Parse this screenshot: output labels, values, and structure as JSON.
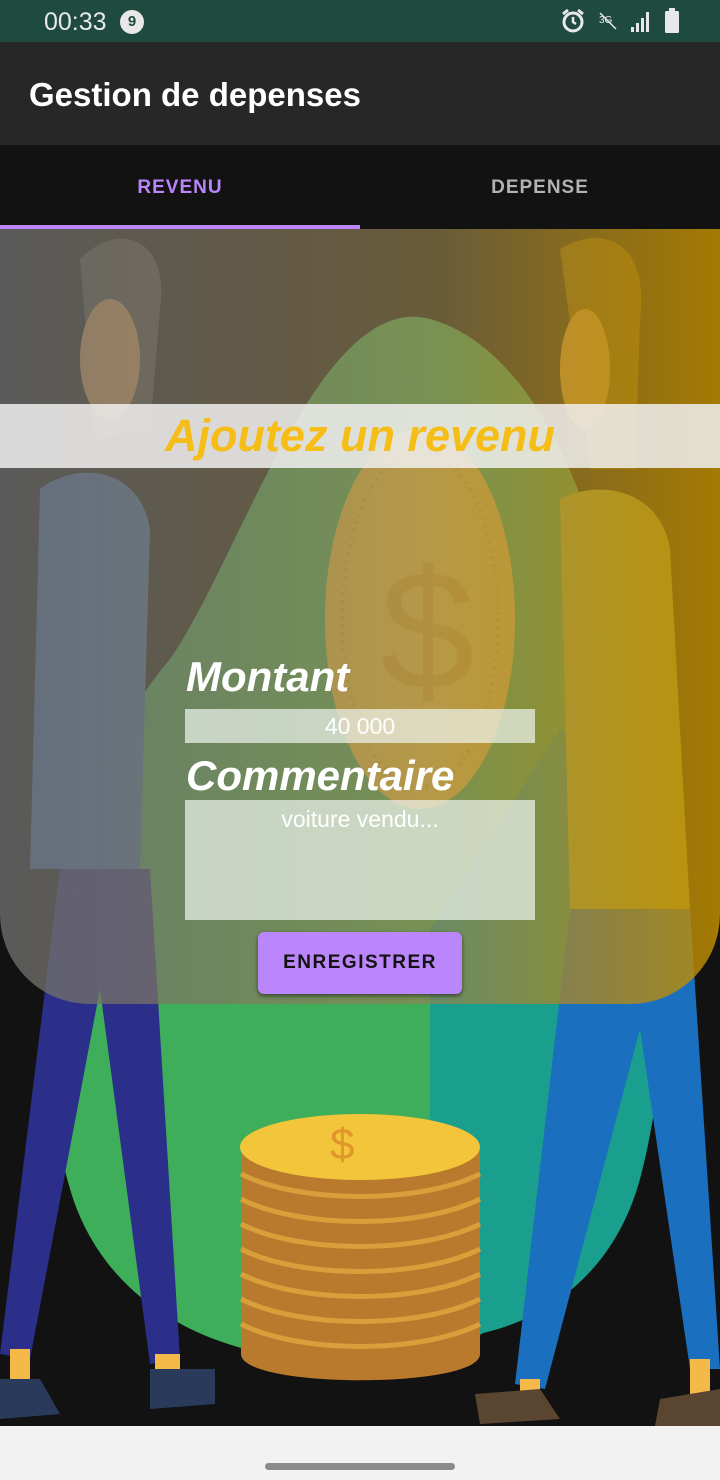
{
  "status_bar": {
    "time": "00:33",
    "notification_count": "9"
  },
  "app_bar": {
    "title": "Gestion de depenses"
  },
  "tabs": [
    {
      "label": "REVENU"
    },
    {
      "label": "DEPENSE"
    }
  ],
  "form": {
    "heading": "Ajoutez un revenu",
    "montant_label": "Montant",
    "montant_placeholder": "40 000",
    "commentaire_label": "Commentaire",
    "commentaire_placeholder": "voiture vendu...",
    "save_label": "ENREGISTRER"
  },
  "colors": {
    "accent": "#bb86fc",
    "heading": "#f6bd16",
    "status_bar": "#1f4a3f",
    "app_bar": "#272727"
  },
  "icons": [
    "alarm-icon",
    "no-data-icon",
    "signal-icon",
    "battery-icon",
    "dollar-coin-illustration"
  ]
}
